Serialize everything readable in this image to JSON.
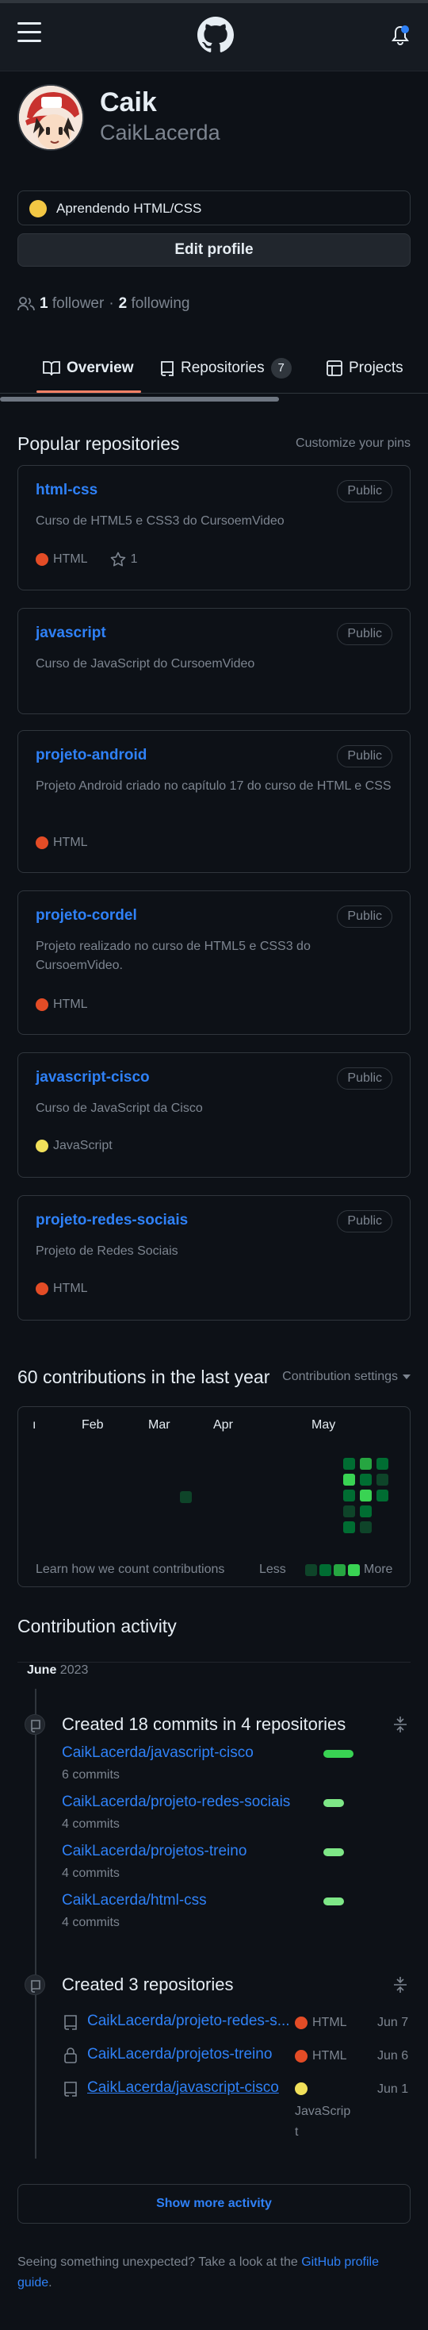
{
  "profile": {
    "name": "Caik",
    "login": "CaikLacerda",
    "status_text": "Aprendendo HTML/CSS",
    "edit_profile_label": "Edit profile",
    "followers_count": "1",
    "followers_label": "follower",
    "separator": "·",
    "following_count": "2",
    "following_label": "following"
  },
  "tabs": [
    {
      "label": "Overview"
    },
    {
      "label": "Repositories",
      "count": "7"
    },
    {
      "label": "Projects"
    }
  ],
  "popular": {
    "title": "Popular repositories",
    "customize_label": "Customize your pins",
    "repos": [
      {
        "name": "html-css",
        "visibility": "Public",
        "description": "Curso de HTML5 e CSS3 do CursoemVideo",
        "language": "HTML",
        "language_color": "#e34c26",
        "stars": "1"
      },
      {
        "name": "javascript",
        "visibility": "Public",
        "description": "Curso de JavaScript do CursoemVideo",
        "language": "",
        "language_color": "",
        "stars": ""
      },
      {
        "name": "projeto-android",
        "visibility": "Public",
        "description": "Projeto Android criado no capítulo 17 do curso de HTML e CSS",
        "language": "HTML",
        "language_color": "#e34c26",
        "stars": ""
      },
      {
        "name": "projeto-cordel",
        "visibility": "Public",
        "description": "Projeto realizado no curso de HTML5 e CSS3 do CursoemVideo.",
        "language": "HTML",
        "language_color": "#e34c26",
        "stars": ""
      },
      {
        "name": "javascript-cisco",
        "visibility": "Public",
        "description": "Curso de JavaScript da Cisco",
        "language": "JavaScript",
        "language_color": "#f1e05a",
        "stars": ""
      },
      {
        "name": "projeto-redes-sociais",
        "visibility": "Public",
        "description": "Projeto de Redes Sociais",
        "language": "HTML",
        "language_color": "#e34c26",
        "stars": ""
      }
    ]
  },
  "contributions": {
    "title": "60 contributions in the last year",
    "settings_label": "Contribution settings",
    "months": [
      "ı",
      "Feb",
      "Mar",
      "Apr",
      "May"
    ],
    "learn_label": "Learn how we count contributions",
    "less_label": "Less",
    "more_label": "More"
  },
  "activity": {
    "title": "Contribution activity",
    "month_bold": "June",
    "month_year": "2023",
    "commits_heading": "Created 18 commits in 4 repositories",
    "commit_repos": [
      {
        "name": "CaikLacerda/javascript-cisco",
        "commits": "6 commits"
      },
      {
        "name": "CaikLacerda/projeto-redes-sociais",
        "commits": "4 commits"
      },
      {
        "name": "CaikLacerda/projetos-treino",
        "commits": "4 commits"
      },
      {
        "name": "CaikLacerda/html-css",
        "commits": "4 commits"
      }
    ],
    "created_heading": "Created 3 repositories",
    "created_repos": [
      {
        "name": "CaikLacerda/projeto-redes-s...",
        "language": "HTML",
        "language_color": "#e34c26",
        "date": "Jun 7"
      },
      {
        "name": "CaikLacerda/projetos-treino",
        "language": "HTML",
        "language_color": "#e34c26",
        "date": "Jun 6"
      },
      {
        "name": "CaikLacerda/javascript-cisco",
        "language_line1": "JavaScrip",
        "language_line2": "t",
        "language_color": "#f1e05a",
        "date": "Jun 1"
      }
    ],
    "show_more_label": "Show more activity"
  },
  "footer": {
    "text": "Seeing something unexpected? Take a look at the",
    "link_part1": "GitHub profile",
    "link_part2": "guide",
    "end": "."
  },
  "colors": {
    "background": "#0d1117",
    "accent_link": "#2f81f7",
    "tab_active": "#f78166",
    "html": "#e34c26",
    "javascript": "#f1e05a",
    "contrib_1": "#0e4429",
    "contrib_2": "#006d32",
    "contrib_3": "#26a641",
    "contrib_4": "#39d353"
  }
}
